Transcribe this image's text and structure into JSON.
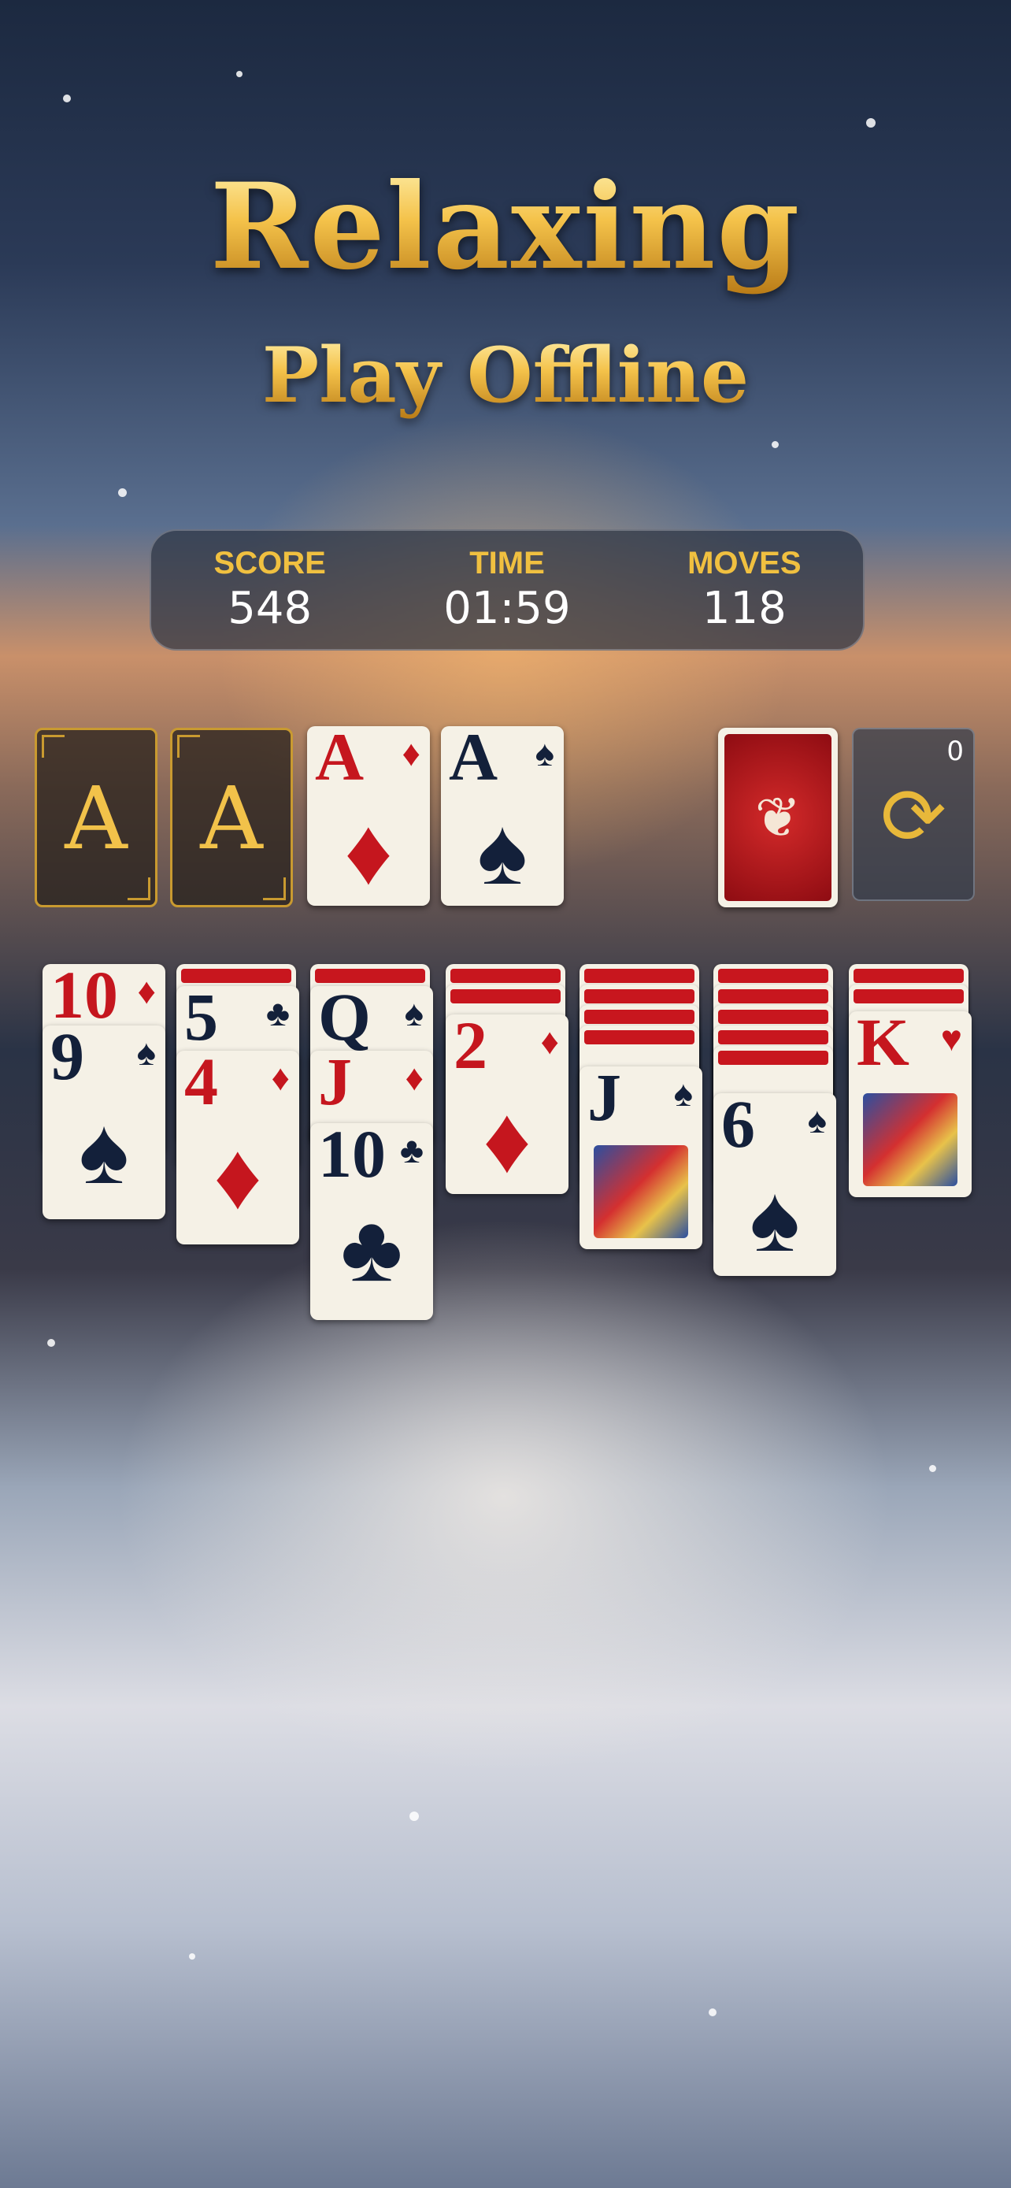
{
  "headline": {
    "title": "Relaxing",
    "subtitle": "Play Offline"
  },
  "stats": {
    "score_label": "SCORE",
    "score_value": "548",
    "time_label": "TIME",
    "time_value": "01:59",
    "moves_label": "MOVES",
    "moves_value": "118"
  },
  "foundations": [
    {
      "empty_label": "A"
    },
    {
      "empty_label": "A"
    },
    {
      "rank": "A",
      "suit": "♦",
      "color": "red"
    },
    {
      "rank": "A",
      "suit": "♠",
      "color": "black"
    }
  ],
  "stock": {
    "icon": "card-back-ornament-icon",
    "glyph": "❦"
  },
  "waste": {
    "count": "0",
    "icon": "recycle-icon",
    "glyph": "⟳"
  },
  "tableau": {
    "col1": {
      "cards": [
        {
          "rank": "10",
          "suit": "♦",
          "color": "red"
        },
        {
          "rank": "9",
          "suit": "♠",
          "color": "black"
        }
      ]
    },
    "col2": {
      "cards": [
        {
          "rank": "5",
          "suit": "♣",
          "color": "black"
        },
        {
          "rank": "4",
          "suit": "♦",
          "color": "red"
        }
      ]
    },
    "col3": {
      "cards": [
        {
          "rank": "Q",
          "suit": "♠",
          "color": "black"
        },
        {
          "rank": "J",
          "suit": "♦",
          "color": "red"
        },
        {
          "rank": "10",
          "suit": "♣",
          "color": "black"
        }
      ]
    },
    "col4": {
      "cards": [
        {
          "rank": "2",
          "suit": "♦",
          "color": "red"
        }
      ]
    },
    "col5": {
      "cards": [
        {
          "rank": "J",
          "suit": "♠",
          "color": "black"
        }
      ]
    },
    "col6": {
      "cards": [
        {
          "rank": "6",
          "suit": "♠",
          "color": "black"
        }
      ]
    },
    "col7": {
      "cards": [
        {
          "rank": "K",
          "suit": "♥",
          "color": "red"
        }
      ]
    }
  }
}
